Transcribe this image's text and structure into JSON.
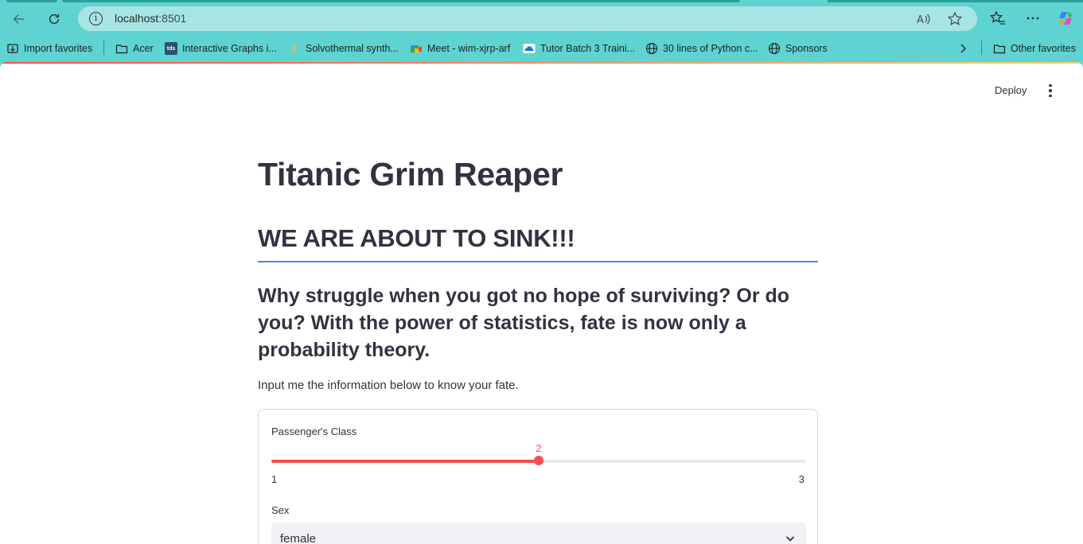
{
  "browser": {
    "url_host": "localhost",
    "url_port": ":8501"
  },
  "favorites": [
    {
      "label": "Import favorites",
      "icon": "import-icon"
    },
    {
      "label": "Acer",
      "icon": "folder-icon"
    },
    {
      "label": "Interactive Graphs i...",
      "icon": "tds-icon",
      "icon_text": "tds"
    },
    {
      "label": "Solvothermal synth...",
      "icon": "page-icon"
    },
    {
      "label": "Meet - wim-xjrp-arf",
      "icon": "meet-icon"
    },
    {
      "label": "Tutor Batch 3 Traini...",
      "icon": "onedrive-icon"
    },
    {
      "label": "30 lines of Python c...",
      "icon": "globe-icon"
    },
    {
      "label": "Sponsors",
      "icon": "globe-icon"
    }
  ],
  "other_favorites": "Other favorites",
  "app": {
    "deploy_label": "Deploy",
    "title": "Titanic Grim Reaper",
    "subheader": "WE ARE ABOUT TO SINK!!!",
    "tagline": "Why struggle when you got no hope of surviving? Or do you? With the power of statistics, fate is now only a probability theory.",
    "instruction": "Input me the information below to know your fate.",
    "form": {
      "class_label": "Passenger's Class",
      "class_value": "2",
      "class_value_num": 2,
      "class_min": "1",
      "class_max": "3",
      "class_min_num": 1,
      "class_max_num": 3,
      "sex_label": "Sex",
      "sex_value": "female"
    }
  },
  "colors": {
    "accent": "#ff4b4b",
    "divider": "#3e8ee6",
    "browser_chrome": "#5ed3d1"
  }
}
